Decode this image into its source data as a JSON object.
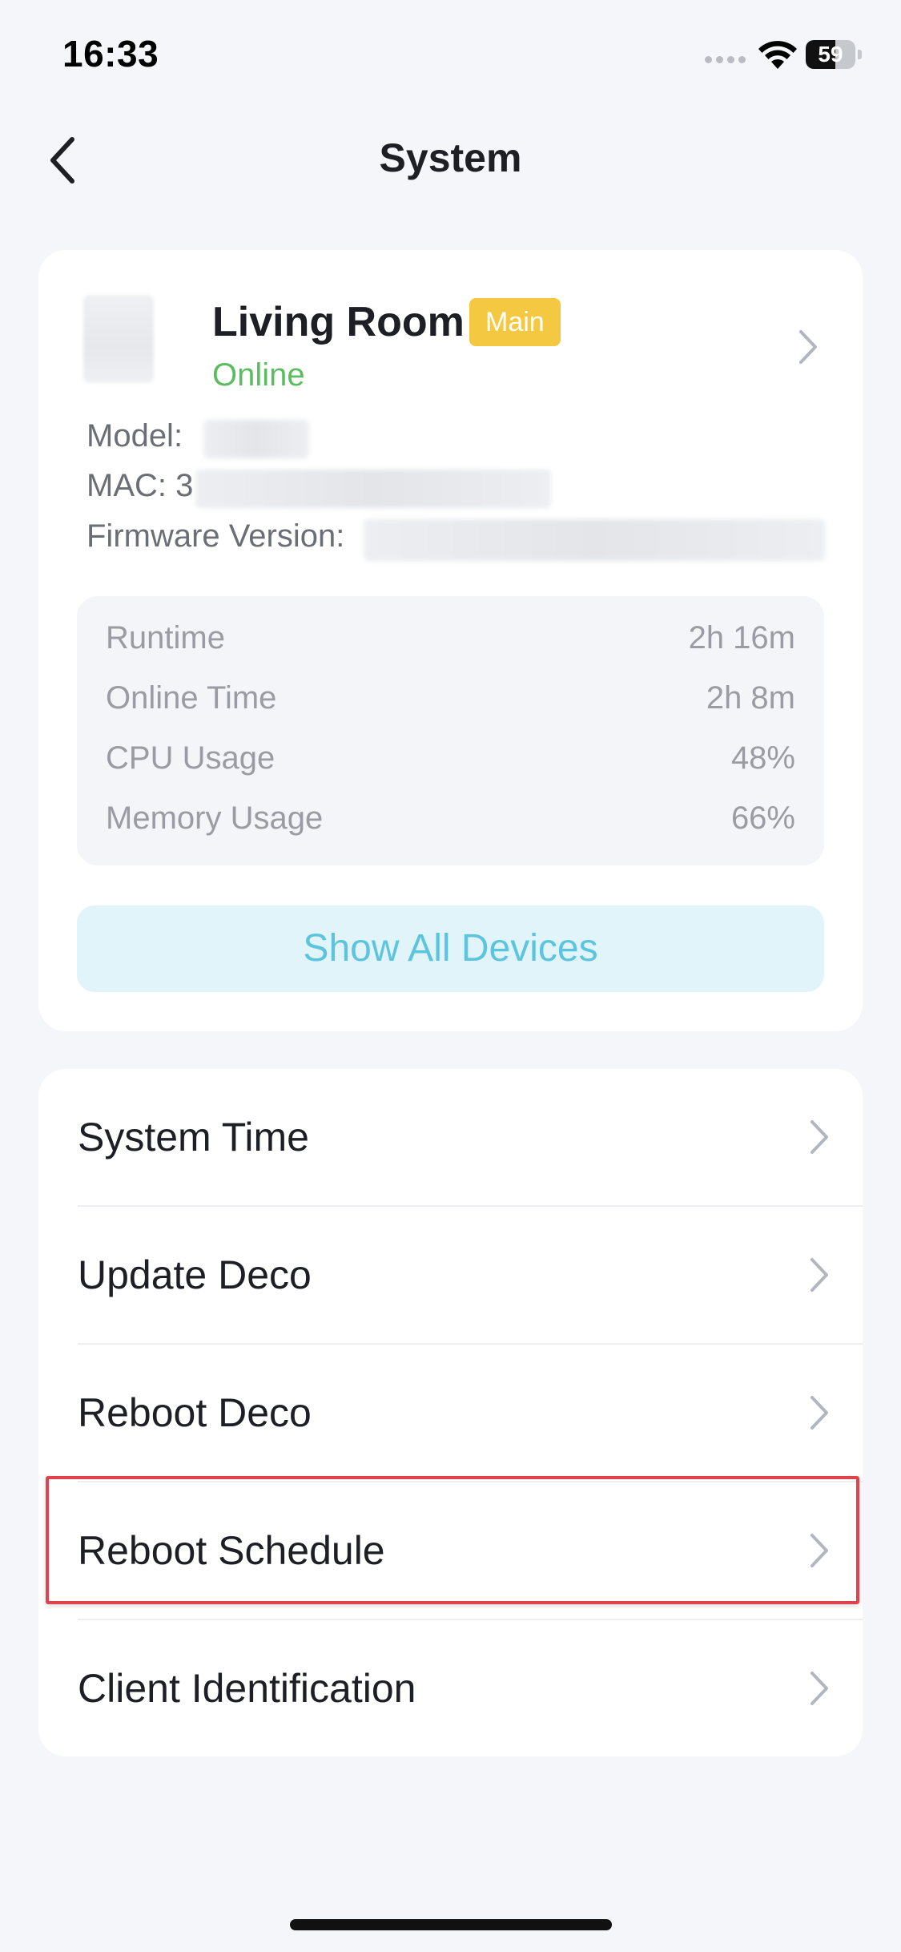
{
  "status_bar": {
    "time": "16:33",
    "battery_level": "59",
    "battery_fraction": 0.59,
    "signal_icon": "cellular-dots-icon",
    "wifi_icon": "wifi-icon"
  },
  "nav": {
    "title": "System",
    "back_icon": "chevron-left-icon"
  },
  "device": {
    "name": "Living Room",
    "badge": "Main",
    "status": "Online",
    "model_label": "Model:",
    "mac_label": "MAC: 3",
    "firmware_label": "Firmware Version:",
    "chevron_icon": "chevron-right-icon",
    "stats": [
      {
        "label": "Runtime",
        "value": "2h 16m"
      },
      {
        "label": "Online Time",
        "value": "2h 8m"
      },
      {
        "label": "CPU Usage",
        "value": "48%"
      },
      {
        "label": "Memory Usage",
        "value": "66%"
      }
    ],
    "show_all_label": "Show All Devices"
  },
  "settings": {
    "items": [
      {
        "label": "System Time"
      },
      {
        "label": "Update Deco"
      },
      {
        "label": "Reboot Deco"
      },
      {
        "label": "Reboot Schedule",
        "highlighted": true
      },
      {
        "label": "Client Identification"
      }
    ]
  },
  "colors": {
    "background": "#f4f6fa",
    "online": "#5bbd60",
    "badge": "#f5c842",
    "accent": "#5dc4de",
    "highlight": "#e0434b"
  }
}
